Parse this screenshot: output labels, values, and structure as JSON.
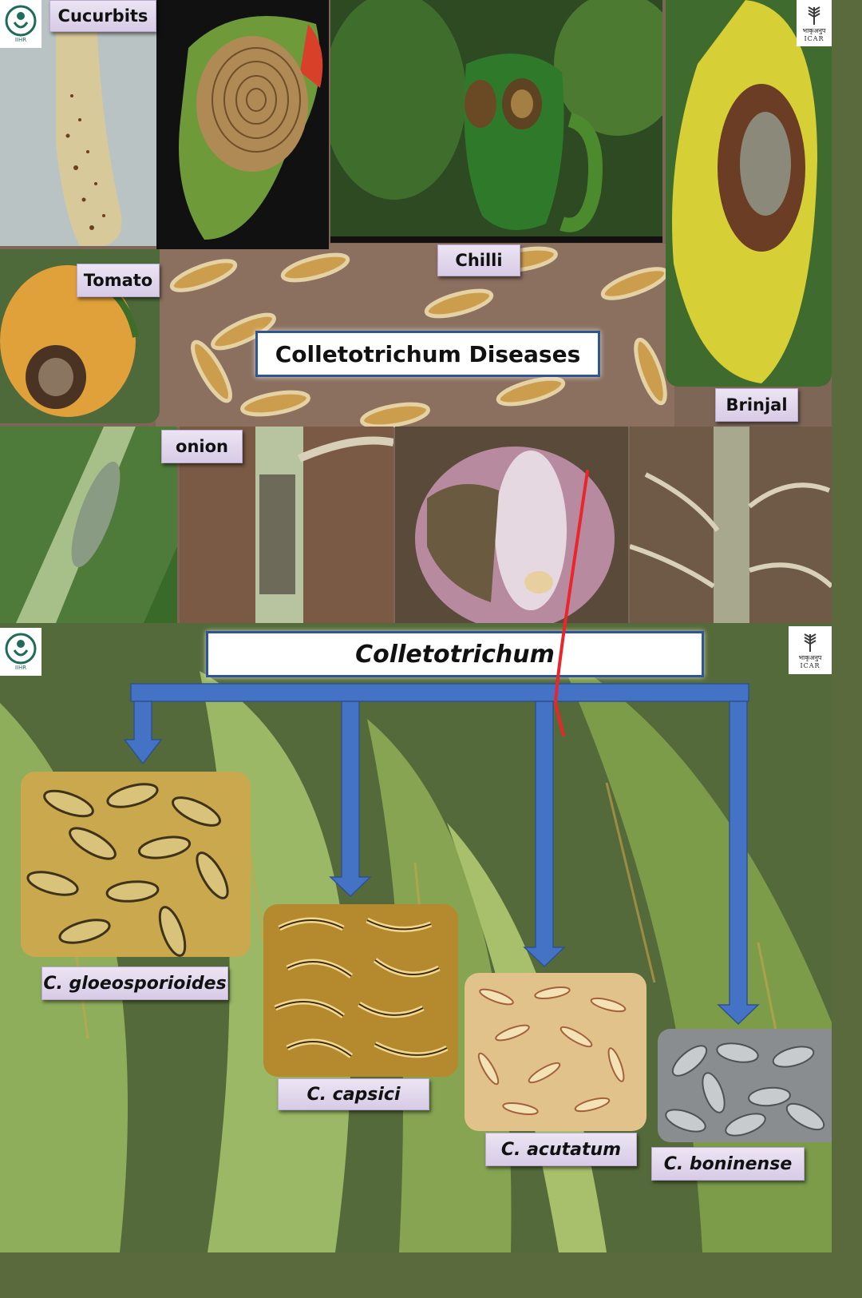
{
  "panel1": {
    "title": "Colletotrichum Diseases",
    "labels": {
      "cucurbits": "Cucurbits",
      "tomato": "Tomato",
      "chilli": "Chilli",
      "brinjal": "Brinjal",
      "onion": "onion"
    }
  },
  "panel2": {
    "title": "Colletotrichum",
    "species": [
      "C. gloeosporioides",
      "C. capsici",
      "C. acutatum",
      "C. boninense"
    ]
  },
  "logos": {
    "left": "IIHR",
    "right_hindi": "भाकृअनुप",
    "right_en": "ICAR"
  },
  "colors": {
    "arrow": "#4472c4",
    "title_border": "#2f5597",
    "label_bg": "#e3d9ee",
    "annotation": "#e8262b"
  }
}
